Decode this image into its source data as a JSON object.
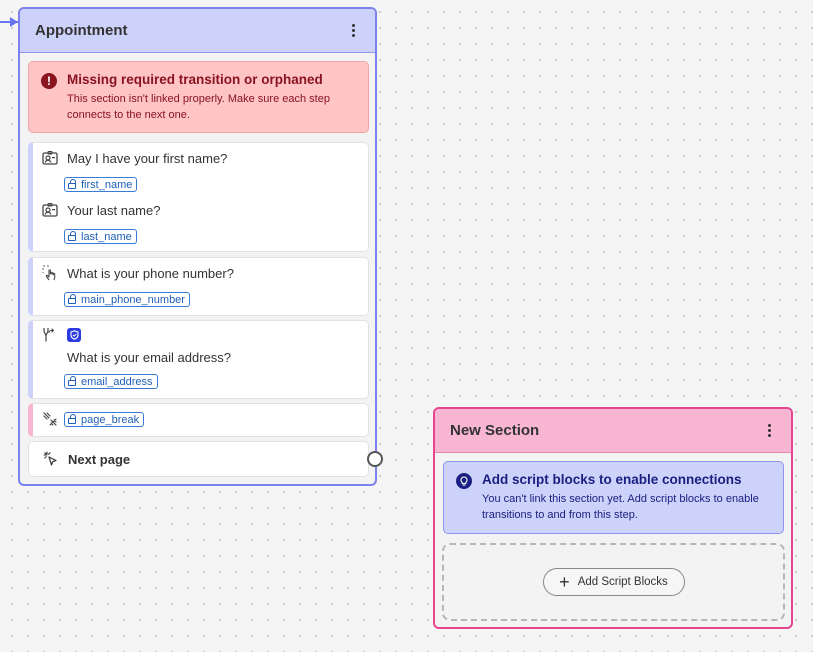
{
  "appointment": {
    "title": "Appointment",
    "error": {
      "title": "Missing required transition or orphaned",
      "line1": "This section isn't linked properly. Make sure each step",
      "line2": "connects to the next one."
    },
    "steps": [
      {
        "question": "May I have your first name?",
        "variable": "first_name",
        "icon": "contact-card-icon"
      },
      {
        "question": "Your last name?",
        "variable": "last_name",
        "icon": "contact-card-icon"
      },
      {
        "question": "What is your phone number?",
        "variable": "main_phone_number",
        "icon": "touch-input-icon"
      },
      {
        "question": "What is your email address?",
        "variable": "email_address",
        "icon": "fork-icon"
      },
      {
        "variable": "page_break",
        "icon": "page-break-icon"
      }
    ],
    "next_page": "Next page"
  },
  "new_section": {
    "title": "New Section",
    "info": {
      "title": "Add script blocks to enable connections",
      "line1": "You can't link this section yet. Add script blocks to enable",
      "line2": "transitions to and from this step."
    },
    "add_button": "Add Script Blocks"
  },
  "colors": {
    "appointment_border": "#7b82f0",
    "appointment_header": "#cdd2fb",
    "error_bg": "#ffc4c4",
    "error_text": "#8a1420",
    "new_section_border": "#e64590",
    "new_section_header": "#f8b6d3",
    "info_text": "#1b2080",
    "chip_blue": "#1f5fb5"
  }
}
